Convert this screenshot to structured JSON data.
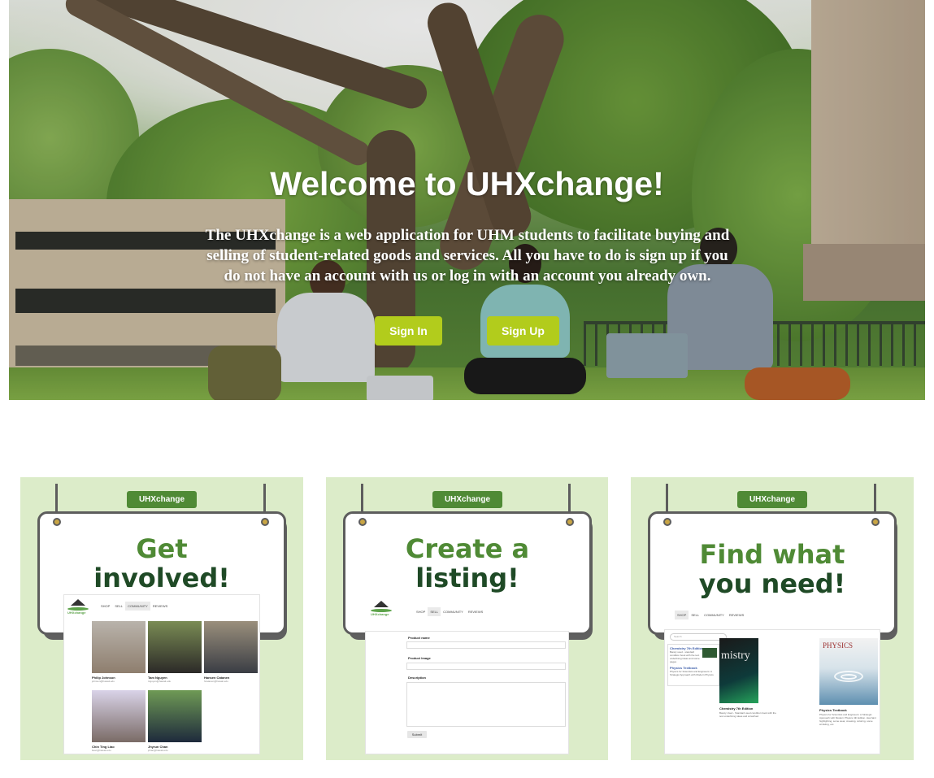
{
  "hero": {
    "title": "Welcome to UHXchange!",
    "description": "The UHXchange is a web application for UHM students to facilitate buying and selling of student-related goods and services. All you have to do is sign up if you do not have an account with us or log in with an account you already own.",
    "sign_in_label": "Sign In",
    "sign_up_label": "Sign Up",
    "button_color": "#b2cc1c"
  },
  "cards": [
    {
      "brand": "UHXchange",
      "title_line1": "Get",
      "title_line2": "involved!",
      "nav": [
        "SHOP",
        "SELL",
        "COMMUNITY",
        "REVIEWS"
      ],
      "active_nav": "COMMUNITY",
      "logo_text": "UHXchange",
      "profiles": [
        {
          "name": "Philip Johnson",
          "email": "johnson@hawaii.edu"
        },
        {
          "name": "Tam Nguyen",
          "email": "tnguyen@hawaii.edu"
        },
        {
          "name": "Hansen Catanen",
          "email": "hcatanen@hawaii.edu"
        },
        {
          "name": "Chin Ting Liao",
          "email": "liaoc@hawaii.edu"
        },
        {
          "name": "Jhyrun Chan",
          "email": "jchan@hawaii.edu"
        }
      ]
    },
    {
      "brand": "UHXchange",
      "title_line1": "Create a",
      "title_line2": "listing!",
      "nav": [
        "SHOP",
        "SELL",
        "COMMUNITY",
        "REVIEWS"
      ],
      "active_nav": "SELL",
      "logo_text": "UHXchange",
      "form": {
        "product_name_label": "Product name",
        "product_image_label": "Product Image",
        "description_label": "Description",
        "submit_label": "Submit"
      }
    },
    {
      "brand": "UHXchange",
      "title_line1": "Find what",
      "title_line2": "you need!",
      "nav": [
        "SHOP",
        "SELL",
        "COMMUNITY",
        "REVIEWS"
      ],
      "active_nav": "SHOP",
      "search_placeholder": "Search",
      "side_items": [
        {
          "title": "Chemistry 7th Edition",
          "desc": "Barely used - standard condition book with the text underlining ideas and some pages"
        },
        {
          "title": "Physics Textbook",
          "desc": "Physics for Scientists and Engineers: A Strategic Approach with Modern Physics"
        }
      ],
      "books": [
        {
          "cover_word": "mistry",
          "title": "Chemistry 7th Edition",
          "desc": "Barely Used - Standard used condition book with the text underlining ideas and scratched"
        },
        {
          "cover_word": "PHYSICS",
          "title": "Physics Textbook",
          "desc": "Physics for Scientists and Engineers: A Strategic Approach with Modern Physics 4th Edition. Has faint highlighting, some wear, creasing, coloring, some wrinkling, etc."
        }
      ]
    }
  ],
  "colors": {
    "card_background": "#dcecc9",
    "brand_green": "#4f8a35",
    "dark_green": "#1f4a26"
  }
}
